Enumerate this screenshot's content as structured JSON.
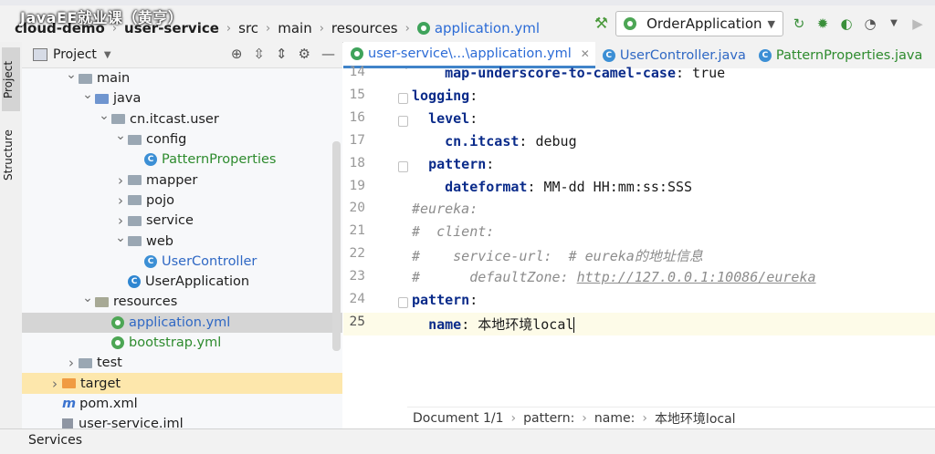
{
  "watermark": "JavaEE就业课（黄亨）",
  "breadcrumb": {
    "items": [
      "cloud-demo",
      "user-service",
      "src",
      "main",
      "resources",
      "application.yml"
    ]
  },
  "toolbar": {
    "run_config": "OrderApplication"
  },
  "sidebar_tabs": {
    "project": "Project",
    "structure": "Structure"
  },
  "project_panel": {
    "title": "Project"
  },
  "tree": [
    {
      "label": "main",
      "indent": 4,
      "arrow": "open",
      "icon": "folder"
    },
    {
      "label": "java",
      "indent": 5,
      "arrow": "open",
      "icon": "folder-blue"
    },
    {
      "label": "cn.itcast.user",
      "indent": 6,
      "arrow": "open",
      "icon": "folder"
    },
    {
      "label": "config",
      "indent": 7,
      "arrow": "open",
      "icon": "folder"
    },
    {
      "label": "PatternProperties",
      "indent": 8,
      "arrow": "none",
      "icon": "class",
      "color": "green"
    },
    {
      "label": "mapper",
      "indent": 7,
      "arrow": "closed",
      "icon": "folder"
    },
    {
      "label": "pojo",
      "indent": 7,
      "arrow": "closed",
      "icon": "folder"
    },
    {
      "label": "service",
      "indent": 7,
      "arrow": "closed",
      "icon": "folder"
    },
    {
      "label": "web",
      "indent": 7,
      "arrow": "open",
      "icon": "folder"
    },
    {
      "label": "UserController",
      "indent": 8,
      "arrow": "none",
      "icon": "class",
      "color": "blue"
    },
    {
      "label": "UserApplication",
      "indent": 7,
      "arrow": "none",
      "icon": "app-class"
    },
    {
      "label": "resources",
      "indent": 5,
      "arrow": "open",
      "icon": "folder-res"
    },
    {
      "label": "application.yml",
      "indent": 6,
      "arrow": "none",
      "icon": "spring",
      "color": "blue",
      "selected": true
    },
    {
      "label": "bootstrap.yml",
      "indent": 6,
      "arrow": "none",
      "icon": "spring",
      "color": "green"
    },
    {
      "label": "test",
      "indent": 4,
      "arrow": "closed",
      "icon": "folder"
    },
    {
      "label": "target",
      "indent": 3,
      "arrow": "closed",
      "icon": "folder-orange",
      "highlight": true
    },
    {
      "label": "pom.xml",
      "indent": 3,
      "arrow": "none",
      "icon": "maven"
    },
    {
      "label": "user-service.iml",
      "indent": 3,
      "arrow": "none",
      "icon": "iml"
    }
  ],
  "editor_tabs": [
    {
      "label": "user-service\\...\\application.yml",
      "active": true,
      "icon": "yml"
    },
    {
      "label": "UserController.java",
      "active": false,
      "icon": "class"
    },
    {
      "label": "PatternProperties.java",
      "active": false,
      "icon": "class"
    }
  ],
  "code_lines": [
    {
      "n": "14",
      "segments": [
        {
          "t": "    "
        },
        {
          "t": "map-underscore-to-camel-case",
          "c": "key"
        },
        {
          "t": ": true"
        }
      ]
    },
    {
      "n": "15",
      "segments": [
        {
          "t": "logging",
          "c": "key"
        },
        {
          "t": ":"
        }
      ]
    },
    {
      "n": "16",
      "segments": [
        {
          "t": "  "
        },
        {
          "t": "level",
          "c": "key"
        },
        {
          "t": ":"
        }
      ]
    },
    {
      "n": "17",
      "segments": [
        {
          "t": "    "
        },
        {
          "t": "cn.itcast",
          "c": "key"
        },
        {
          "t": ": debug"
        }
      ]
    },
    {
      "n": "18",
      "segments": [
        {
          "t": "  "
        },
        {
          "t": "pattern",
          "c": "key"
        },
        {
          "t": ":"
        }
      ]
    },
    {
      "n": "19",
      "segments": [
        {
          "t": "    "
        },
        {
          "t": "dateformat",
          "c": "key"
        },
        {
          "t": ": MM-dd HH:mm:ss:SSS"
        }
      ]
    },
    {
      "n": "20",
      "segments": [
        {
          "t": "#eureka:",
          "c": "cmt"
        }
      ]
    },
    {
      "n": "21",
      "segments": [
        {
          "t": "#  client:",
          "c": "cmt"
        }
      ]
    },
    {
      "n": "22",
      "segments": [
        {
          "t": "#    service-url:  # eureka的地址信息",
          "c": "cmt"
        }
      ]
    },
    {
      "n": "23",
      "segments": [
        {
          "t": "#      defaultZone: ",
          "c": "cmt"
        },
        {
          "t": "http://127.0.0.1:10086/eureka",
          "c": "link"
        }
      ]
    },
    {
      "n": "24",
      "segments": [
        {
          "t": "pattern",
          "c": "key"
        },
        {
          "t": ":"
        }
      ]
    },
    {
      "n": "25",
      "segments": [
        {
          "t": "  "
        },
        {
          "t": "name",
          "c": "key"
        },
        {
          "t": ": 本地环境local"
        }
      ],
      "cursor": true
    }
  ],
  "status_breadcrumb": {
    "document": "Document 1/1",
    "path": [
      "pattern:",
      "name:",
      "本地环境local"
    ]
  },
  "bottom_bar": {
    "services": "Services"
  }
}
